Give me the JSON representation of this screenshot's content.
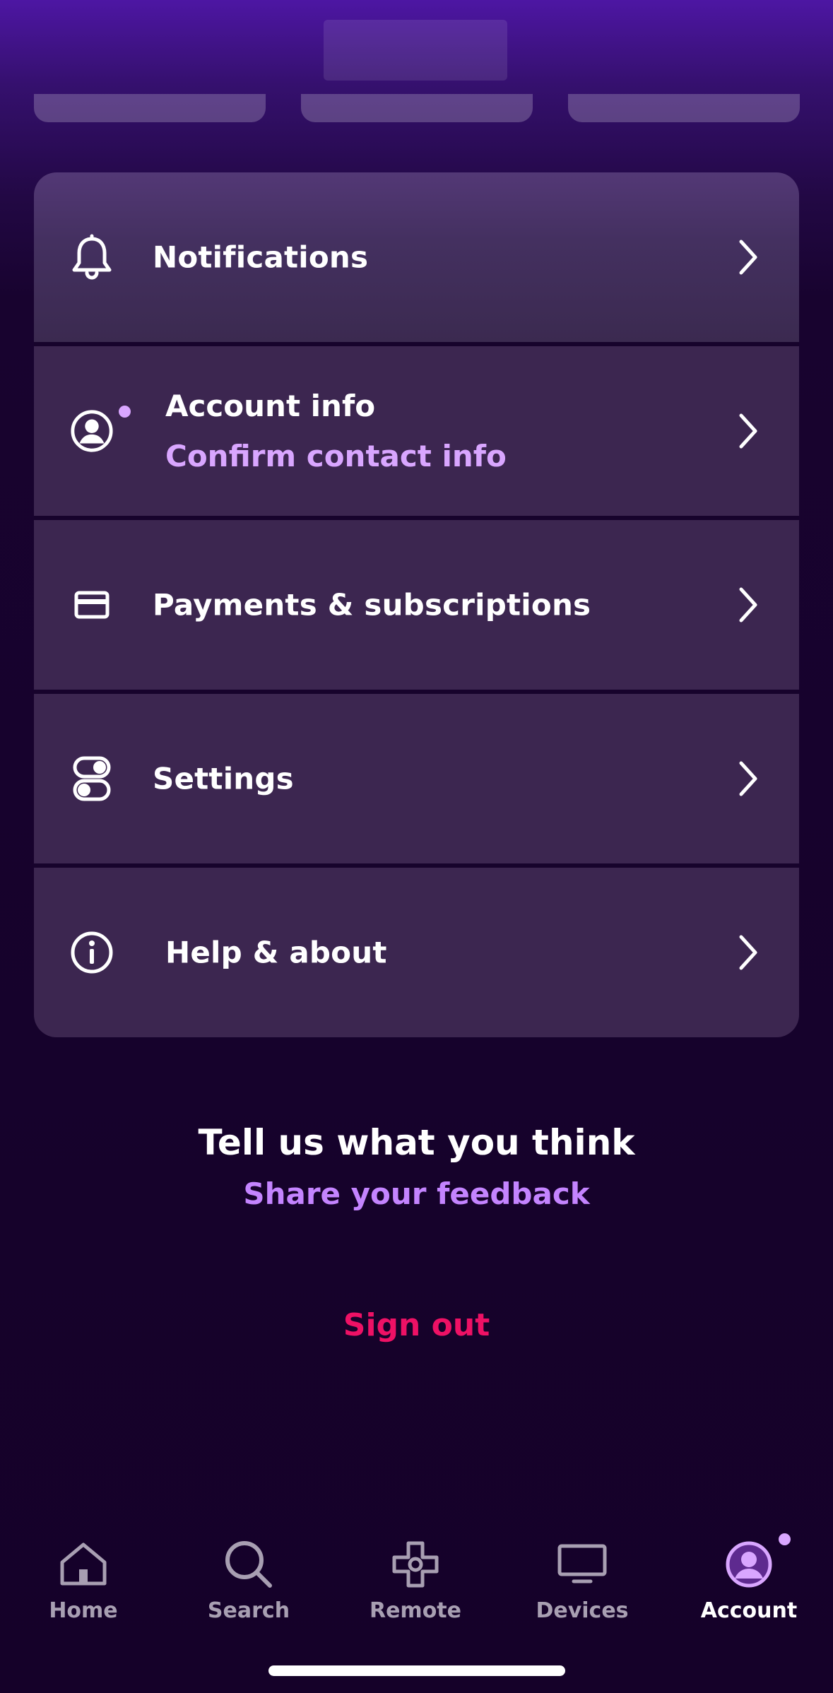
{
  "menu": {
    "items": [
      {
        "label": "Notifications",
        "icon": "bell-icon"
      },
      {
        "label": "Account info",
        "sublabel": "Confirm contact info",
        "icon": "account-circle-icon"
      },
      {
        "label": "Payments & subscriptions",
        "icon": "credit-card-icon"
      },
      {
        "label": "Settings",
        "icon": "toggles-icon"
      },
      {
        "label": "Help & about",
        "icon": "info-icon"
      }
    ]
  },
  "feedback": {
    "title": "Tell us what you think",
    "link": "Share your feedback"
  },
  "sign_out": {
    "label": "Sign out",
    "color": "#ee1165"
  },
  "tabbar": {
    "tabs": [
      {
        "label": "Home",
        "icon": "home-icon"
      },
      {
        "label": "Search",
        "icon": "search-icon"
      },
      {
        "label": "Remote",
        "icon": "remote-dpad-icon"
      },
      {
        "label": "Devices",
        "icon": "tv-icon"
      },
      {
        "label": "Account",
        "icon": "account-circle-icon",
        "active": true
      }
    ]
  },
  "colors": {
    "accent": "#d9a6ff",
    "link": "#c484ff",
    "row_bg": "#3c2650",
    "page_bg": "#150129"
  }
}
